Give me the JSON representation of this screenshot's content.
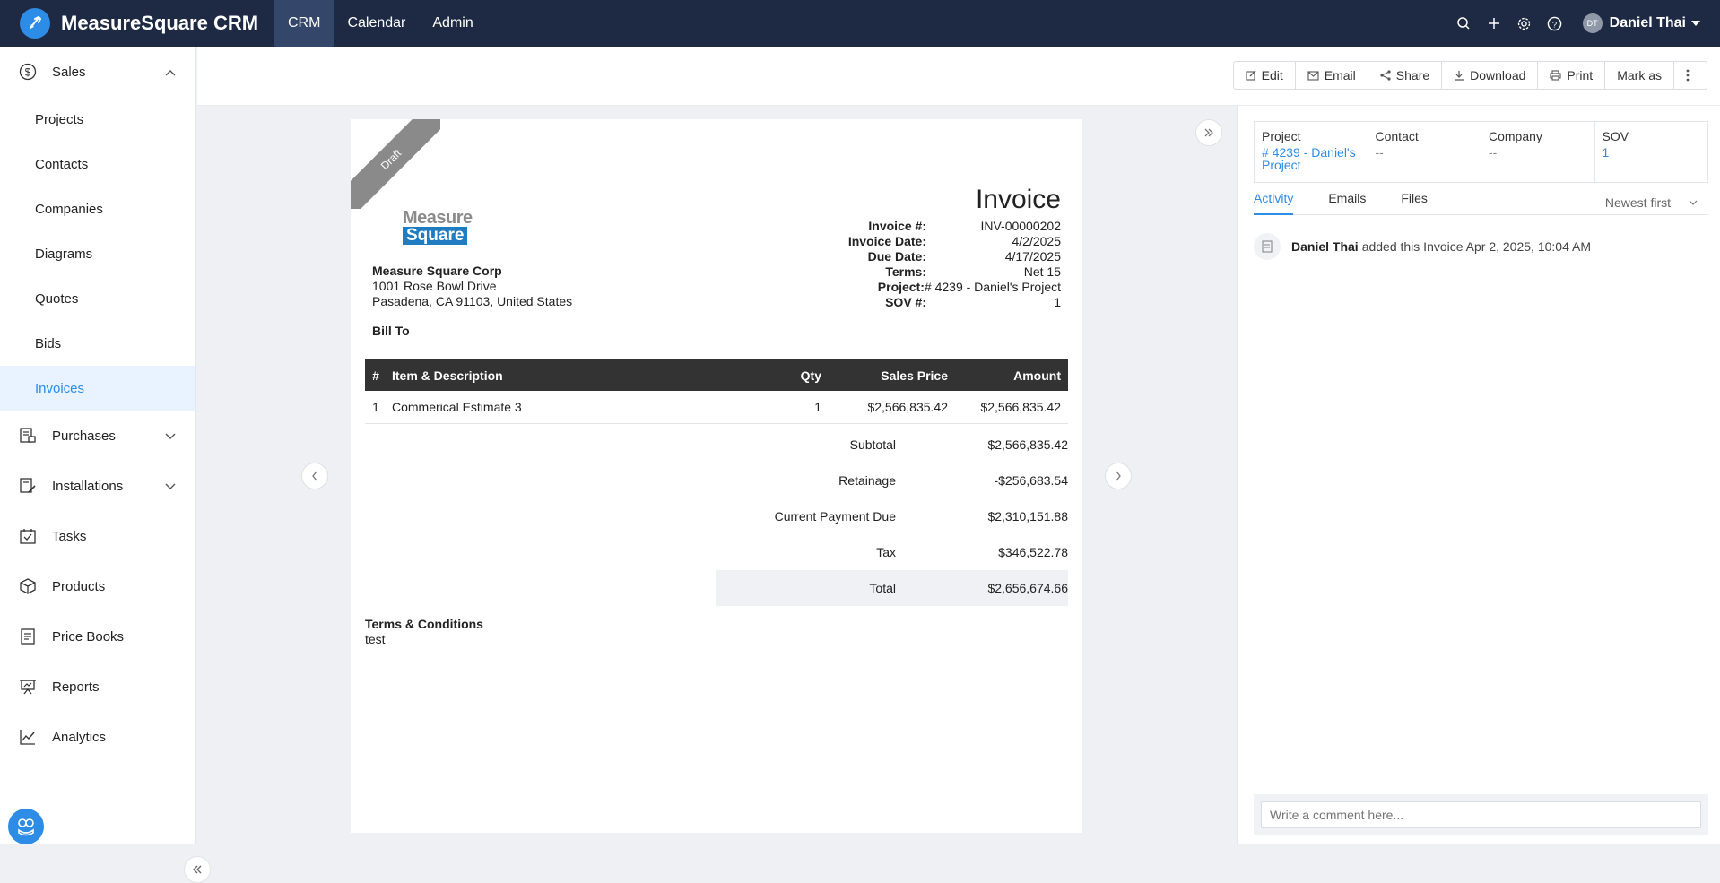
{
  "app": {
    "title": "MeasureSquare CRM"
  },
  "nav": [
    {
      "label": "CRM"
    },
    {
      "label": "Calendar"
    },
    {
      "label": "Admin"
    }
  ],
  "user": {
    "initials": "DT",
    "name": "Daniel Thai"
  },
  "sidebar": {
    "sales": "Sales",
    "sales_items": [
      "Projects",
      "Contacts",
      "Companies",
      "Diagrams",
      "Quotes",
      "Bids",
      "Invoices"
    ],
    "purchases": "Purchases",
    "installations": "Installations",
    "tasks": "Tasks",
    "products": "Products",
    "price_books": "Price Books",
    "reports": "Reports",
    "analytics": "Analytics"
  },
  "toolbar": {
    "edit": "Edit",
    "email": "Email",
    "share": "Share",
    "download": "Download",
    "print": "Print",
    "mark_as": "Mark as"
  },
  "invoice": {
    "ribbon": "Draft",
    "logo_top": "Measure",
    "logo_bottom": "Square",
    "title": "Invoice",
    "company": "Measure Square Corp",
    "address1": "1001 Rose Bowl Drive",
    "address2": "Pasadena, CA 91103, United States",
    "bill_to": "Bill To",
    "meta": [
      {
        "k": "Invoice #:",
        "v": "INV-00000202"
      },
      {
        "k": "Invoice Date:",
        "v": "4/2/2025"
      },
      {
        "k": "Due Date:",
        "v": "4/17/2025"
      },
      {
        "k": "Terms:",
        "v": "Net 15"
      },
      {
        "k": "Project:",
        "v": "# 4239 - Daniel's Project"
      },
      {
        "k": "SOV #:",
        "v": "1"
      }
    ],
    "columns": {
      "num": "#",
      "item": "Item & Description",
      "qty": "Qty",
      "price": "Sales Price",
      "amount": "Amount"
    },
    "rows": [
      {
        "num": "1",
        "item": "Commerical Estimate 3",
        "qty": "1",
        "price": "$2,566,835.42",
        "amount": "$2,566,835.42"
      }
    ],
    "totals": [
      {
        "k": "Subtotal",
        "v": "$2,566,835.42"
      },
      {
        "k": "Retainage",
        "v": "-$256,683.54"
      },
      {
        "k": "Current Payment Due",
        "v": "$2,310,151.88"
      },
      {
        "k": "Tax",
        "v": "$346,522.78"
      },
      {
        "k": "Total",
        "v": "$2,656,674.66"
      }
    ],
    "terms_title": "Terms & Conditions",
    "terms_text": "test"
  },
  "panel": {
    "project_label": "Project",
    "project_value": "# 4239 - Daniel's Project",
    "contact_label": "Contact",
    "contact_value": "--",
    "company_label": "Company",
    "company_value": "--",
    "sov_label": "SOV",
    "sov_value": "1",
    "tabs": [
      "Activity",
      "Emails",
      "Files"
    ],
    "sort": "Newest first",
    "activity_user": "Daniel Thai",
    "activity_text": "added this Invoice Apr 2, 2025, 10:04 AM",
    "comment_placeholder": "Write a comment here..."
  },
  "colors": {
    "topbar": "#1e2a44",
    "accent": "#2c8ce6",
    "table_header": "#333333"
  }
}
